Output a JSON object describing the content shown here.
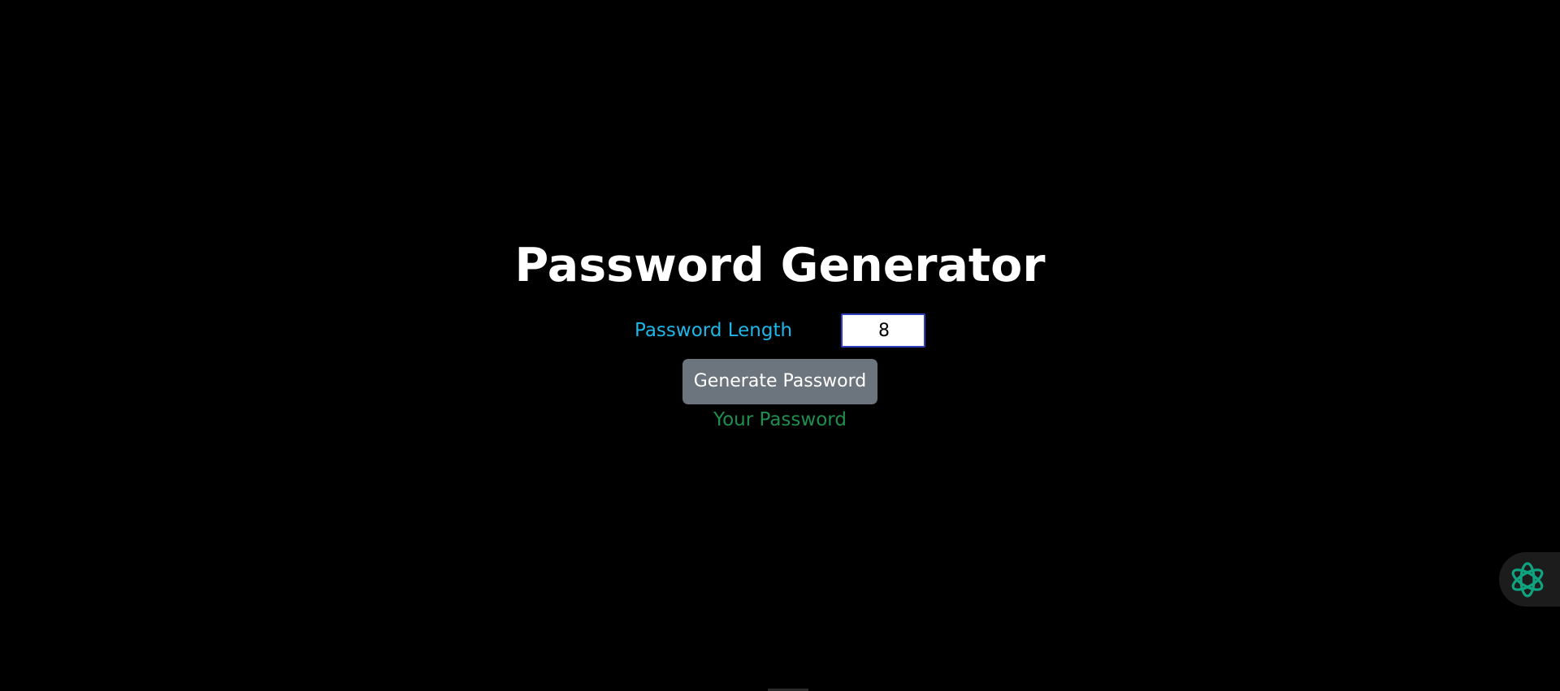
{
  "header": {
    "title": "Password Generator"
  },
  "form": {
    "length_label": "Password Length",
    "length_value": "8"
  },
  "actions": {
    "generate_label": "Generate Password"
  },
  "output": {
    "password_text": "Your Password"
  },
  "colors": {
    "background": "#000000",
    "title": "#ffffff",
    "label": "#1fb6e8",
    "button": "#6c757d",
    "result": "#1e8f4e",
    "widget_icon": "#10a37f"
  },
  "icons": {
    "assistant_widget": "assistant-knot-icon"
  }
}
